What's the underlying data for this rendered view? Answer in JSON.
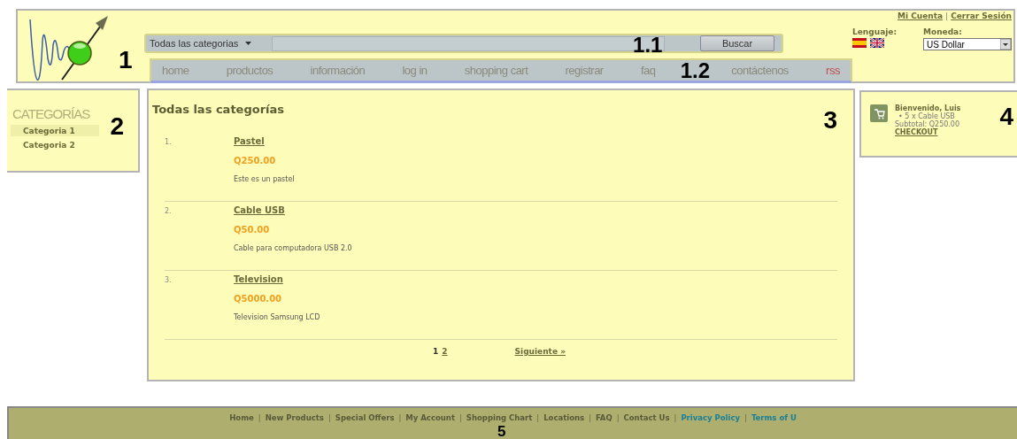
{
  "header": {
    "marker": "1",
    "search": {
      "category": "Todas las categorias",
      "button": "Buscar",
      "marker": "1.1"
    },
    "nav": {
      "marker": "1.2",
      "items": [
        {
          "label": "home",
          "color": "#8a8a7a"
        },
        {
          "label": "productos",
          "color": "#8a8a7a"
        },
        {
          "label": "información",
          "color": "#8a8a7a"
        },
        {
          "label": "log in",
          "color": "#8a8a7a"
        },
        {
          "label": "shopping cart",
          "color": "#8a8a7a"
        },
        {
          "label": "registrar",
          "color": "#8a8a7a"
        },
        {
          "label": "faq",
          "color": "#8a8a7a"
        },
        {
          "label": "contáctenos",
          "color": "#8a8a7a"
        },
        {
          "label": "rss",
          "color": "#c0504d"
        }
      ]
    },
    "account_links": [
      "Mi Cuenta",
      "Cerrar Sesión"
    ],
    "link_separator": "|",
    "language": {
      "label": "Lenguaje:"
    },
    "currency": {
      "label": "Moneda:",
      "value": "US Dollar"
    }
  },
  "categories": {
    "title": "CATEGORÍAS",
    "marker": "2",
    "items": [
      {
        "label": "Categoria 1",
        "selected": true
      },
      {
        "label": "Categoria 2",
        "selected": false
      }
    ]
  },
  "products": {
    "title": "Todas las categorías",
    "marker": "3",
    "items": [
      {
        "number": "1.",
        "name": "Pastel",
        "price": "Q250.00",
        "description": "Este es un pastel"
      },
      {
        "number": "2.",
        "name": "Cable USB",
        "price": "Q50.00",
        "description": "Cable para computadora USB 2.0"
      },
      {
        "number": "3.",
        "name": "Television",
        "price": "Q5000.00",
        "description": "Television Samsung LCD"
      }
    ],
    "pagination": {
      "pages": [
        {
          "label": "1",
          "selected": true
        },
        {
          "label": "2",
          "selected": false
        }
      ],
      "next": "Siguiente »"
    }
  },
  "cart": {
    "marker": "4",
    "greeting": "Bienvenido, Luis",
    "bullet": "•",
    "items": [
      "5 x Cable USB"
    ],
    "subtotal": "Subtotal: Q250.00",
    "checkout": "CHECKOUT"
  },
  "footer": {
    "marker": "5",
    "separator": "|",
    "links": [
      {
        "label": "Home",
        "color": "#5a5a3a"
      },
      {
        "label": "New Products",
        "color": "#5a5a3a"
      },
      {
        "label": "Special Offers",
        "color": "#5a5a3a"
      },
      {
        "label": "My Account",
        "color": "#5a5a3a"
      },
      {
        "label": "Shopping Chart",
        "color": "#5a5a3a"
      },
      {
        "label": "Locations",
        "color": "#5a5a3a"
      },
      {
        "label": "FAQ",
        "color": "#5a5a3a"
      },
      {
        "label": "Contact Us",
        "color": "#5a5a3a"
      },
      {
        "label": "Privacy Policy",
        "color": "#1a7f96"
      },
      {
        "label": "Terms of U",
        "color": "#1a7f96"
      }
    ]
  }
}
